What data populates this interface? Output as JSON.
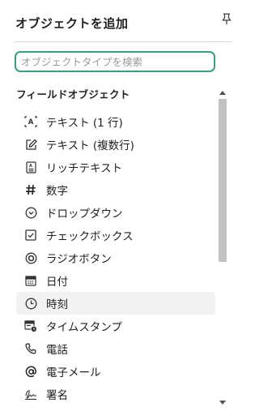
{
  "panel": {
    "title": "オブジェクトを追加",
    "pin_icon": "pin-icon"
  },
  "search": {
    "placeholder": "オブジェクトタイプを検索",
    "value": "",
    "focus_color": "#3a9f7a"
  },
  "section": {
    "title": "フィールドオブジェクト"
  },
  "items": [
    {
      "label": "テキスト (1 行)",
      "icon": "text-single-line-icon"
    },
    {
      "label": "テキスト (複数行)",
      "icon": "text-multi-line-icon"
    },
    {
      "label": "リッチテキスト",
      "icon": "rich-text-icon"
    },
    {
      "label": "数字",
      "icon": "hash-icon"
    },
    {
      "label": "ドロップダウン",
      "icon": "dropdown-icon"
    },
    {
      "label": "チェックボックス",
      "icon": "checkbox-icon"
    },
    {
      "label": "ラジオボタン",
      "icon": "radio-icon"
    },
    {
      "label": "日付",
      "icon": "calendar-icon"
    },
    {
      "label": "時刻",
      "icon": "clock-icon",
      "hovered": true
    },
    {
      "label": "タイムスタンプ",
      "icon": "timestamp-icon"
    },
    {
      "label": "電話",
      "icon": "phone-icon"
    },
    {
      "label": "電子メール",
      "icon": "at-icon"
    },
    {
      "label": "署名",
      "icon": "signature-icon"
    }
  ],
  "scrollbar": {
    "position_fraction": 0.0,
    "visible_fraction": 0.55
  }
}
